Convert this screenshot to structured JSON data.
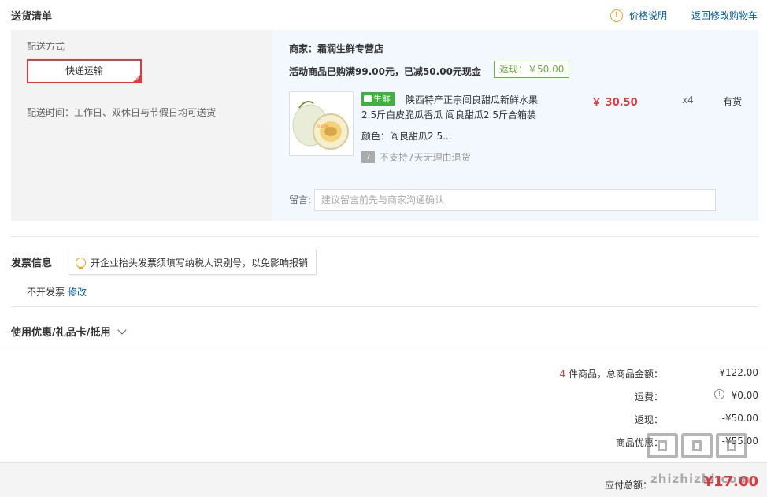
{
  "header": {
    "title": "送货清单",
    "price_info": "价格说明",
    "back_to_cart": "返回修改购物车"
  },
  "shipping": {
    "label": "配送方式",
    "method": "快递运输",
    "time": "配送时间：工作日、双休日与节假日均可送货"
  },
  "store": {
    "merchant": "商家：霜润生鲜专营店",
    "promo": "活动商品已购满99.00元，已减50.00元现金",
    "rebate": "返现：￥50.00",
    "product": {
      "badge": "生鲜",
      "name_line1": "陕西特产正宗阎良甜瓜新鲜水果",
      "name_line2": "2.5斤白皮脆瓜香瓜 阎良甜瓜2.5斤合箱装",
      "color": "颜色：阎良甜瓜2.5...",
      "no_return_icon": "7",
      "no_return": "不支持7天无理由退货",
      "price": "￥ 30.50",
      "qty": "x4",
      "stock": "有货"
    },
    "note": {
      "label": "留言:",
      "placeholder": "建议留言前先与商家沟通确认"
    }
  },
  "invoice": {
    "title": "发票信息",
    "tip": "开企业抬头发票须填写纳税人识别号，以免影响报销",
    "value": "不开发票",
    "edit": "修改"
  },
  "coupon": {
    "label": "使用优惠/礼品卡/抵用"
  },
  "summary": {
    "count": "4",
    "count_label": " 件商品，总商品金额：",
    "goods_total": "¥122.00",
    "shipping_label": "运费：",
    "shipping_fee": "¥0.00",
    "cashback_label": "返现：",
    "cashback": "-¥50.00",
    "discount_label": "商品优惠：",
    "discount": "-¥55.00",
    "payable_label": "应付总额：",
    "payable": "¥17.00"
  },
  "watermark": {
    "text": "zhizhizhi.com"
  },
  "colors": {
    "accent_red": "#e4393c",
    "link_blue": "#005aa0",
    "fresh_green": "#3cb33a",
    "rebate_green": "#6fae3f"
  }
}
